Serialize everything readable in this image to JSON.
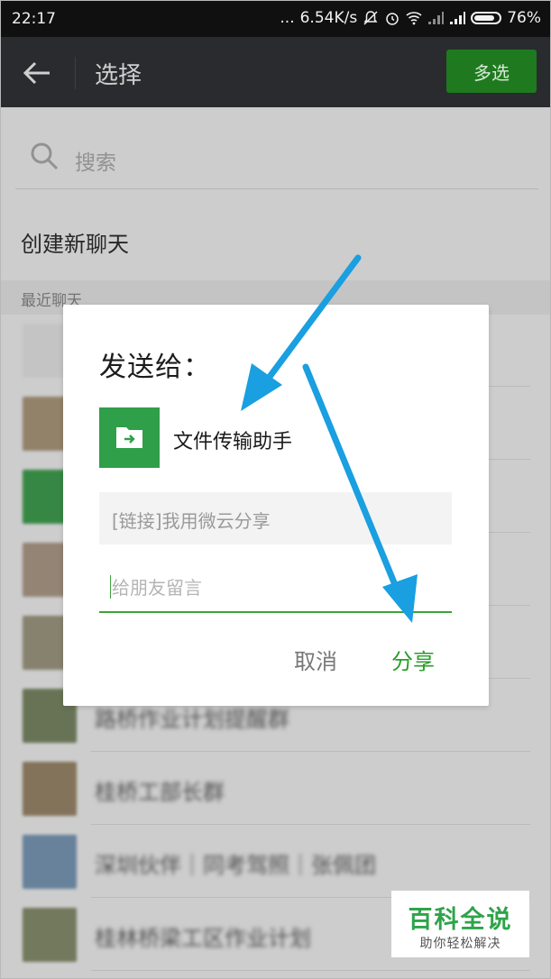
{
  "status_bar": {
    "time": "22:17",
    "dots": "...",
    "speed": "6.54K/s",
    "battery_percent": "76%",
    "battery_level": 0.76,
    "icons": [
      "mute-icon",
      "alarm-icon",
      "wifi-icon",
      "signal-icon",
      "signal-icon",
      "battery-icon"
    ]
  },
  "app_bar": {
    "title": "选择",
    "multi_select_label": "多选",
    "accent": "#1f7a1f"
  },
  "search": {
    "placeholder": "搜索"
  },
  "new_chat_label": "创建新聊天",
  "recent_header": "最近聊天",
  "chat_rows": [
    {
      "name": "",
      "avatar_color": "#cfcfcf"
    },
    {
      "name": "",
      "avatar_color": "#9a8a70"
    },
    {
      "name": "",
      "avatar_color": "#3a8f48"
    },
    {
      "name": "",
      "avatar_color": "#9b8c7b"
    },
    {
      "name": "",
      "avatar_color": "#8e8a74"
    },
    {
      "name": "路桥作业计划提醒群",
      "avatar_color": "#6e7a5a"
    },
    {
      "name": "桂桥工部长群",
      "avatar_color": "#8c7a60"
    },
    {
      "name": "深圳伙伴｜同考驾照｜张佩团",
      "avatar_color": "#6d8aa3"
    },
    {
      "name": "桂林桥梁工区作业计划",
      "avatar_color": "#7a8062"
    }
  ],
  "dialog": {
    "title": "发送给：",
    "recipient_name": "文件传输助手",
    "recipient_icon": "folder-arrow-icon",
    "link_text": "[链接]我用微云分享",
    "message_placeholder": "给朋友留言",
    "cancel_label": "取消",
    "share_label": "分享",
    "primary_color": "#2a9d2a"
  },
  "watermark": {
    "title": "百科全说",
    "subtitle": "助你轻松解决"
  }
}
